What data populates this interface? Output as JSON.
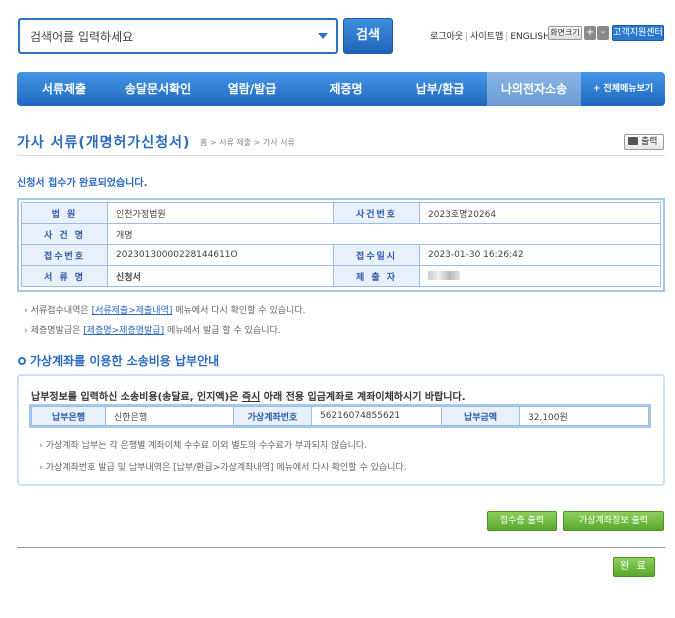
{
  "search": {
    "placeholder": "검색어를 입력하세요",
    "button": "검색"
  },
  "util": {
    "logout": "로그아웃",
    "sitemap": "사이트맵",
    "english": "ENGLISH",
    "font_size": "화면크기",
    "font_plus": "+",
    "font_minus": "-",
    "help_center": "고객지원센터"
  },
  "nav": {
    "items": [
      "서류제출",
      "송달문서확인",
      "열람/발급",
      "제증명",
      "납부/환급",
      "나의전자소송"
    ],
    "all_menu": "+ 전체메뉴보기",
    "active_index": 5
  },
  "page": {
    "title": "가사 서류(개명허가신청서)",
    "breadcrumb": "홈 > 서류 제출 > 가사 서류",
    "print_label": "출력",
    "notice": "신청서 접수가 완료되었습니다."
  },
  "info": {
    "court_label": "법 원",
    "court_value": "인천가정법원",
    "case_no_label": "사건번호",
    "case_no_value": "2023호명20264",
    "case_name_label": "사 건 명",
    "case_name_value": "개명",
    "receipt_no_label": "접수번호",
    "receipt_no_value": "20230130000228144611O",
    "receipt_date_label": "접수일시",
    "receipt_date_value": "2023-01-30 16:26:42",
    "doc_name_label": "서 류 명",
    "doc_name_value": "신청서",
    "submitter_label": "제 출 자"
  },
  "notes": {
    "note1_pre": "서류접수내역은",
    "note1_link": "[서류제출>제출내역]",
    "note1_post": "메뉴에서 다시 확인할 수 있습니다.",
    "note2_pre": "제증명발급은",
    "note2_link": "[제증명>제증명발급]",
    "note2_post": "메뉴에서 발급 할 수 있습니다."
  },
  "payment": {
    "section_title": "가상계좌를 이용한 소송비용 납부안내",
    "msg_pre": "납부정보를 입력하신 소송비용(송달료, 인지액)은",
    "msg_emph": "즉시",
    "msg_post": "아래 전용 입금계좌로 계좌이체하시기 바랍니다.",
    "bank_label": "납부은행",
    "bank_value": "신한은행",
    "account_label": "가상계좌번호",
    "account_value": "56216074855621",
    "amount_label": "납부금액",
    "amount_value": "32,100원",
    "note1": "가상계좌 납부는 각 은행별 계좌이체 수수료 이외 별도의 수수료가 부과되지 않습니다.",
    "note2": "가상계좌번호 발급 및 납부내역은 [납부/환급>가상계좌내역] 메뉴에서 다시 확인할 수 있습니다."
  },
  "buttons": {
    "receipt_print": "접수증 출력",
    "account_print": "가상계좌정보 출력",
    "done": "완 료"
  }
}
